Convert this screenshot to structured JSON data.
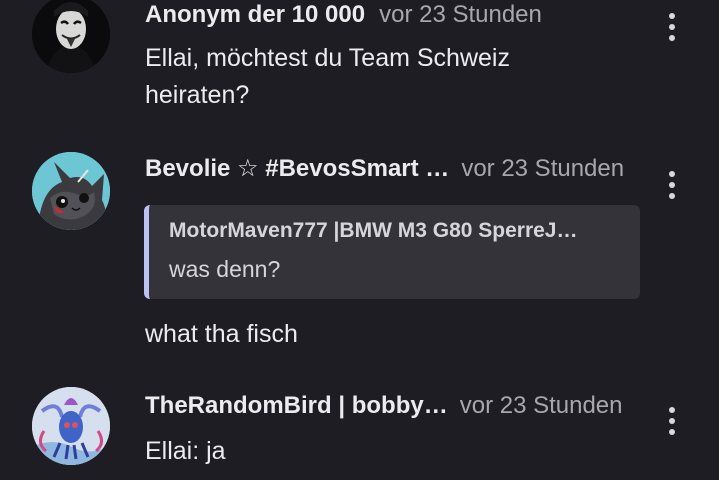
{
  "comments": [
    {
      "author": "Anonym der 10 000",
      "time": "vor 23 Stunden",
      "text_lines": [
        "Ellai, möchtest du Team Schweiz",
        "heiraten?"
      ],
      "avatar": "anonymous-mask-icon"
    },
    {
      "author": "Bevolie ☆ #BevosSmart …",
      "time": "vor 23 Stunden",
      "quote": {
        "author": "MotorMaven777 |BMW M3 G80 SperreJ…",
        "text": "was denn?"
      },
      "text": "what tha fisch",
      "avatar": "cartoon-cat-avatar"
    },
    {
      "author": "TheRandomBird | bobby…",
      "time": "vor 23 Stunden",
      "text": "Ellai: ja",
      "avatar": "blue-creature-avatar"
    }
  ],
  "colors": {
    "background": "#1e1d23",
    "quote_background": "#34333a",
    "quote_accent": "#bcc1f7",
    "muted_text": "#a7a7ad"
  }
}
